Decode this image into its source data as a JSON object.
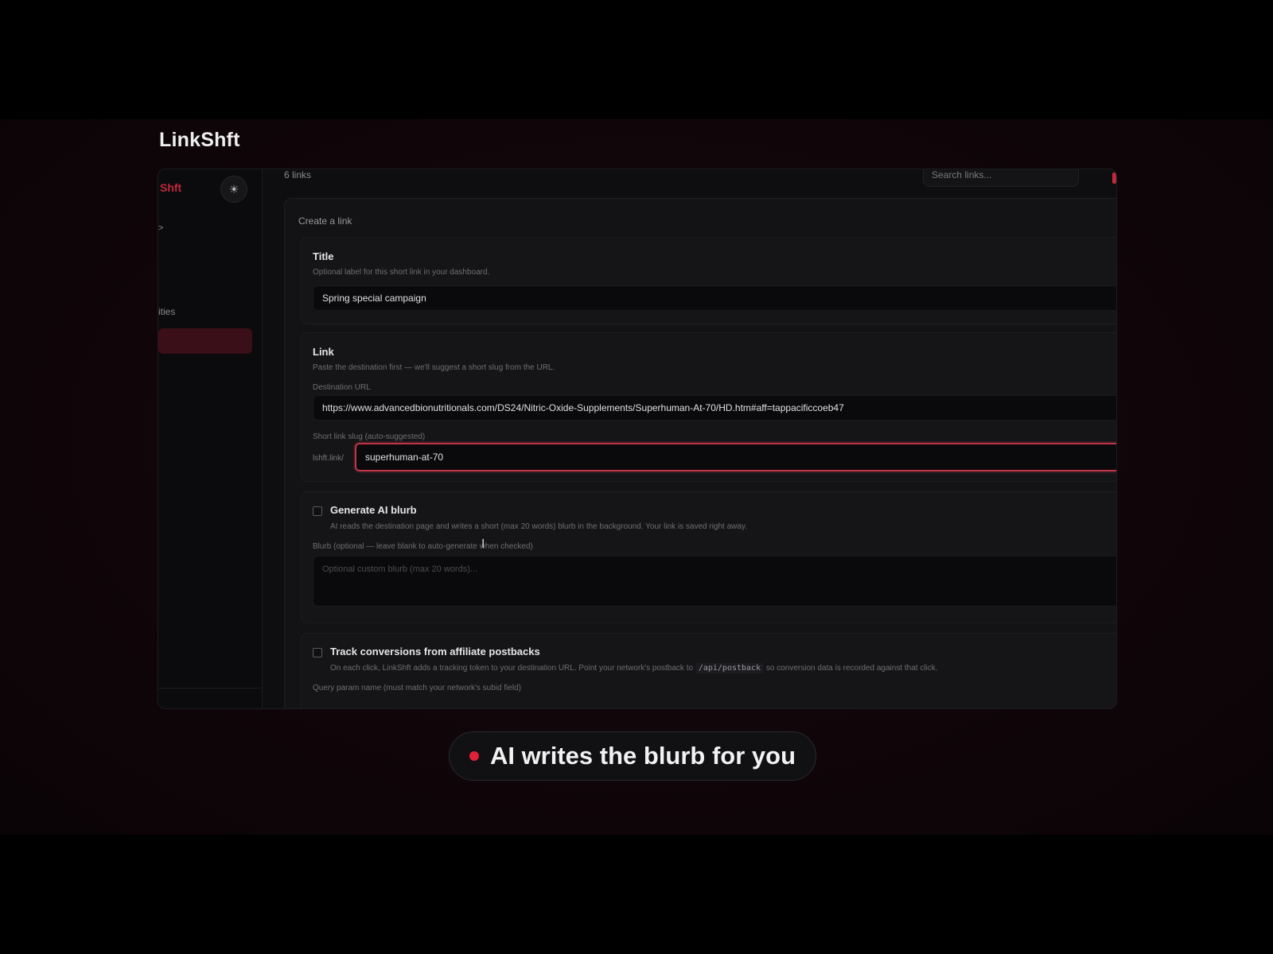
{
  "app": {
    "brand": "LinkShft"
  },
  "sidebar": {
    "logo_fragment": "Shft",
    "theme_icon": "sun-icon",
    "frag_top": ">",
    "frag_nav": "ities"
  },
  "header": {
    "links_count": "6 links",
    "search_placeholder": "Search links..."
  },
  "form": {
    "card_title": "Create a link",
    "title_section": {
      "label": "Title",
      "help": "Optional label for this short link in your dashboard.",
      "value": "Spring special campaign"
    },
    "link_section": {
      "label": "Link",
      "help": "Paste the destination first — we'll suggest a short slug from the URL.",
      "dest_label": "Destination URL",
      "dest_value": "https://www.advancedbionutritionals.com/DS24/Nitric-Oxide-Supplements/Superhuman-At-70/HD.htm#aff=tappacificcoeb47",
      "slug_label": "Short link slug (auto-suggested)",
      "slug_prefix": "lshft.link/",
      "slug_value": "superhuman-at-70"
    },
    "blurb_section": {
      "checkbox_label": "Generate AI blurb",
      "checkbox_help": "AI reads the destination page and writes a short (max 20 words) blurb in the background. Your link is saved right away.",
      "blurb_label": "Blurb (optional — leave blank to auto-generate when checked)",
      "blurb_placeholder": "Optional custom blurb (max 20 words)...",
      "checked": false
    },
    "tracking_section": {
      "checkbox_label": "Track conversions from affiliate postbacks",
      "help_before": "On each click, LinkShft adds a tracking token to your destination URL. Point your network's postback to",
      "help_code": "/api/postback",
      "help_after": "so conversion data is recorded against that click.",
      "param_label": "Query param name (must match your network's subid field)",
      "checked": false
    }
  },
  "caption": {
    "text": "AI writes the blurb for you",
    "accent": "#e0213a"
  },
  "colors": {
    "accent": "#c23549",
    "background": "#0e0e10"
  }
}
